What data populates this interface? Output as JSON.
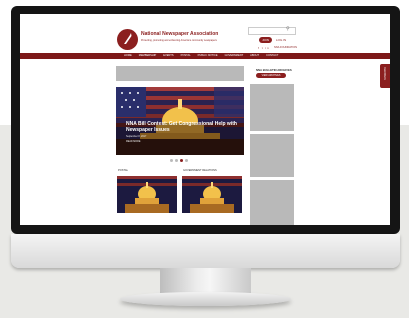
{
  "site": {
    "org_name": "National Newspaper Association",
    "tagline": "Protecting, promoting and enhancing America's community newspapers"
  },
  "header": {
    "search_placeholder": "",
    "search_icon": "search-icon",
    "join_label": "JOIN",
    "login_label": "LOG IN",
    "social_icons": [
      "facebook-icon",
      "twitter-icon",
      "linkedin-icon"
    ],
    "social_text": "NNA FOUNDATION"
  },
  "nav": {
    "items": [
      "HOME",
      "MEMBERSHIP",
      "EVENTS",
      "POSTAL",
      "PUBLIC NOTICE",
      "GOVERNMENT",
      "ABOUT",
      "CONTACT"
    ]
  },
  "hero": {
    "title": "NNA Bill Contest: Get Congressional Help with Newspaper Issues",
    "meta": "September 8, 2017",
    "meta2": "READ MORE"
  },
  "slider": {
    "dots": 4,
    "active": 2
  },
  "cards": [
    {
      "label": "POSTAL"
    },
    {
      "label": "GOVERNMENT RELATIONS"
    }
  ],
  "sidebar": {
    "title": "NNA BULLETIN ARCHIVES",
    "button_label": "VIEW ARCHIVES"
  },
  "side_tab": {
    "label": "FEEDBACK"
  },
  "colors": {
    "brand": "#8b1f1f",
    "nav": "#7d1818",
    "placeholder": "#b9b9b9"
  }
}
